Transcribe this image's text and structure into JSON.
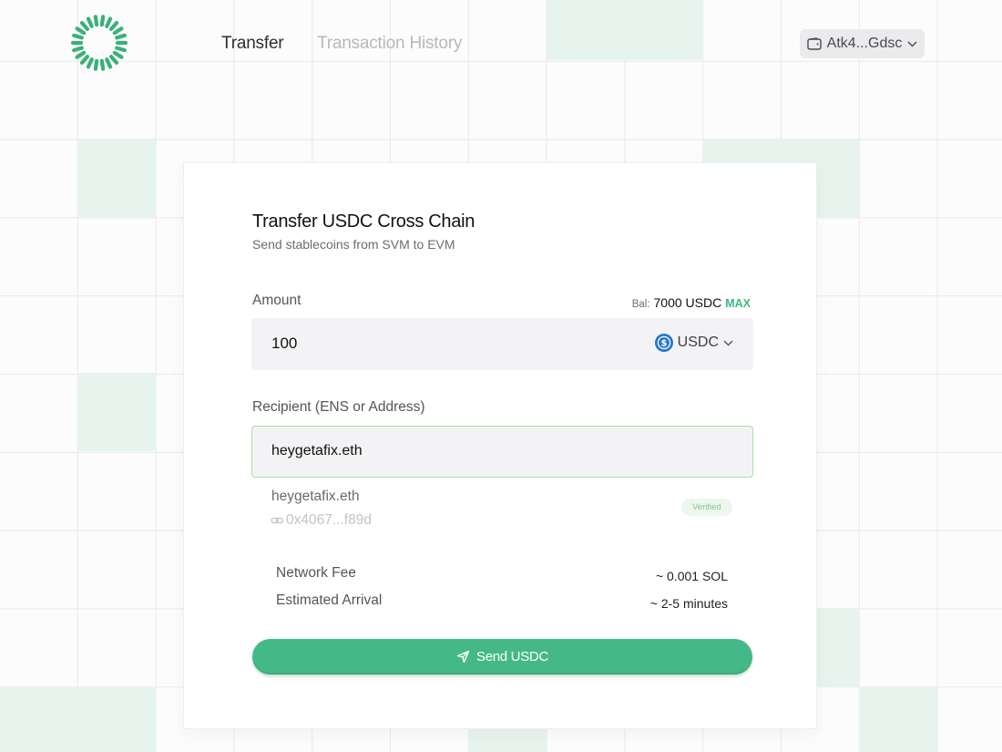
{
  "nav": {
    "tabs": [
      {
        "label": "Transfer",
        "active": true
      },
      {
        "label": "Transaction History",
        "active": false
      }
    ]
  },
  "wallet": {
    "label": "Atk4...Gdsc",
    "icon": "wallet-icon"
  },
  "card": {
    "title": "Transfer USDC Cross Chain",
    "subtitle": "Send stablecoins from SVM to EVM",
    "amount": {
      "label": "Amount",
      "balance_prefix": "Bal:",
      "balance_value": "7000 USDC",
      "max_label": "MAX",
      "value": "100",
      "token": "USDC"
    },
    "recipient": {
      "label": "Recipient (ENS or Address)",
      "value": "heygetafix.eth",
      "resolved_name": "heygetafix.eth",
      "resolved_address": "0x4067...f89d",
      "verified_label": "Verified"
    },
    "info": [
      {
        "label": "Network Fee",
        "value": "~ 0.001 SOL"
      },
      {
        "label": "Estimated Arrival",
        "value": "~ 2-5 minutes"
      }
    ],
    "send_label": "Send USDC"
  },
  "colors": {
    "accent": "#44b987",
    "grid_tile": "#e7f4ee",
    "usdc_blue": "#2775ca"
  }
}
